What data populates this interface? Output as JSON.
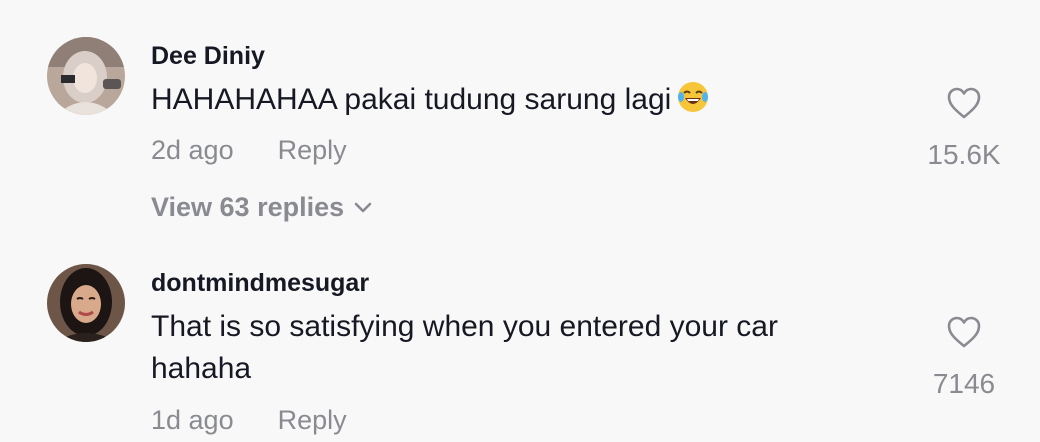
{
  "comments": [
    {
      "username": "Dee Diniy",
      "text": "HAHAHAHAA pakai tudung sarung lagi",
      "emoji_icon": "laughing-tears-emoji-icon",
      "time": "2d ago",
      "reply_label": "Reply",
      "like_count": "15.6K",
      "view_replies_label": "View 63 replies"
    },
    {
      "username": "dontmindmesugar",
      "text": "That is so satisfying when you entered your car hahaha",
      "time": "1d ago",
      "reply_label": "Reply",
      "like_count": "7146"
    }
  ],
  "colors": {
    "background": "#f8f8f8",
    "primary_text": "#161823",
    "secondary_text": "#8a8b91"
  }
}
